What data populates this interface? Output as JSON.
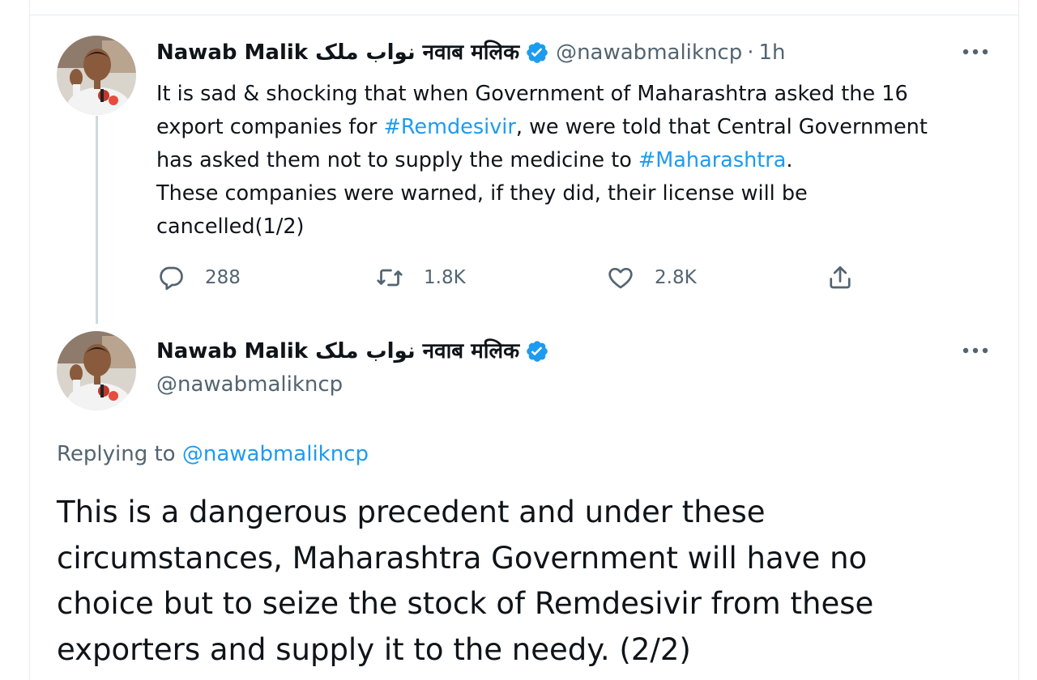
{
  "colors": {
    "accent": "#1d9bf0",
    "text": "#0f1419",
    "muted": "#536471",
    "divider": "#e6ecf0"
  },
  "tweet1": {
    "author": {
      "display_name": "Nawab Malik نواب ملک नवाब मलिक",
      "handle": "@nawabmalikncp",
      "verified": true
    },
    "time": "1h",
    "separator": "·",
    "text_lines": [
      [
        {
          "text": "It is sad & shocking that when Government of Maharashtra asked the 16"
        }
      ],
      [
        {
          "text": "export companies for "
        },
        {
          "text": "#Remdesivir",
          "hashtag": true
        },
        {
          "text": ", we were told that Central Government"
        }
      ],
      [
        {
          "text": "has asked them not to supply the medicine to "
        },
        {
          "text": "#Maharashtra",
          "hashtag": true
        },
        {
          "text": "."
        }
      ],
      [
        {
          "text": "These companies were warned, if they did, their license will be"
        }
      ],
      [
        {
          "text": "cancelled(1/2)"
        }
      ]
    ],
    "actions": {
      "reply_count": "288",
      "retweet_count": "1.8K",
      "like_count": "2.8K"
    },
    "icons": [
      "avatar",
      "verified-badge-icon",
      "more-options-icon",
      "reply-icon",
      "retweet-icon",
      "like-icon",
      "share-icon"
    ]
  },
  "tweet2": {
    "author": {
      "display_name": "Nawab Malik نواب ملک नवाब मलिक",
      "handle": "@nawabmalikncp",
      "verified": true
    },
    "replying_prefix": "Replying to",
    "replying_to": "@nawabmalikncp",
    "text_lines": [
      "This is a dangerous precedent and under these",
      "circumstances, Maharashtra Government will have no",
      "choice but to seize the stock of Remdesivir from these",
      "exporters and supply it to the needy. (2/2)"
    ]
  }
}
